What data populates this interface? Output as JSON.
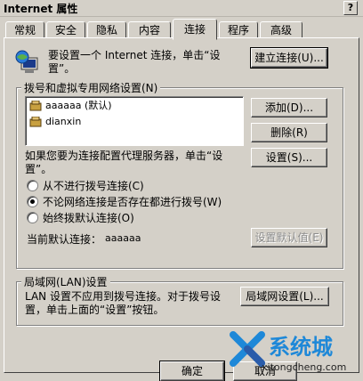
{
  "window": {
    "title": "Internet 属性",
    "help_glyph": "?"
  },
  "tabs": [
    {
      "label": "常规"
    },
    {
      "label": "安全"
    },
    {
      "label": "隐私"
    },
    {
      "label": "内容"
    },
    {
      "label": "连接"
    },
    {
      "label": "程序"
    },
    {
      "label": "高级"
    }
  ],
  "active_tab": "连接",
  "connection": {
    "intro_text_line1": "要设置一个 Internet 连接，单击“设",
    "intro_text_line2": "置”。",
    "setup_button": "建立连接(U)..."
  },
  "dialup": {
    "group_label": "拨号和虚拟专用网络设置(N)",
    "items": [
      {
        "label": "aaaaaa (默认)"
      },
      {
        "label": "dianxin"
      }
    ],
    "add_button": "添加(D)...",
    "delete_button": "删除(R)",
    "proxy_text_line1": "如果您要为连接配置代理服务器，单击“设",
    "proxy_text_line2": "置”。",
    "settings_button": "设置(S)...",
    "options": [
      {
        "label": "从不进行拨号连接(C)",
        "selected": false
      },
      {
        "label": "不论网络连接是否存在都进行拨号(W)",
        "selected": true
      },
      {
        "label": "始终拨默认连接(O)",
        "selected": false
      }
    ],
    "current_default_label": "当前默认连接：",
    "current_default_value": "aaaaaa",
    "set_default_button": "设置默认值(E)"
  },
  "lan": {
    "group_label": "局域网(LAN)设置",
    "text_line1": "LAN 设置不应用到拨号连接。对于拨号设",
    "text_line2": "置，单击上面的“设置”按钮。",
    "lan_settings_button": "局域网设置(L)..."
  },
  "footer": {
    "ok_button": "确定",
    "cancel_button": "取消"
  },
  "watermark": {
    "brand": "系统城",
    "url": "xitongcheng.com",
    "colors": {
      "brand": "#1e88d8",
      "url": "#222222"
    }
  }
}
